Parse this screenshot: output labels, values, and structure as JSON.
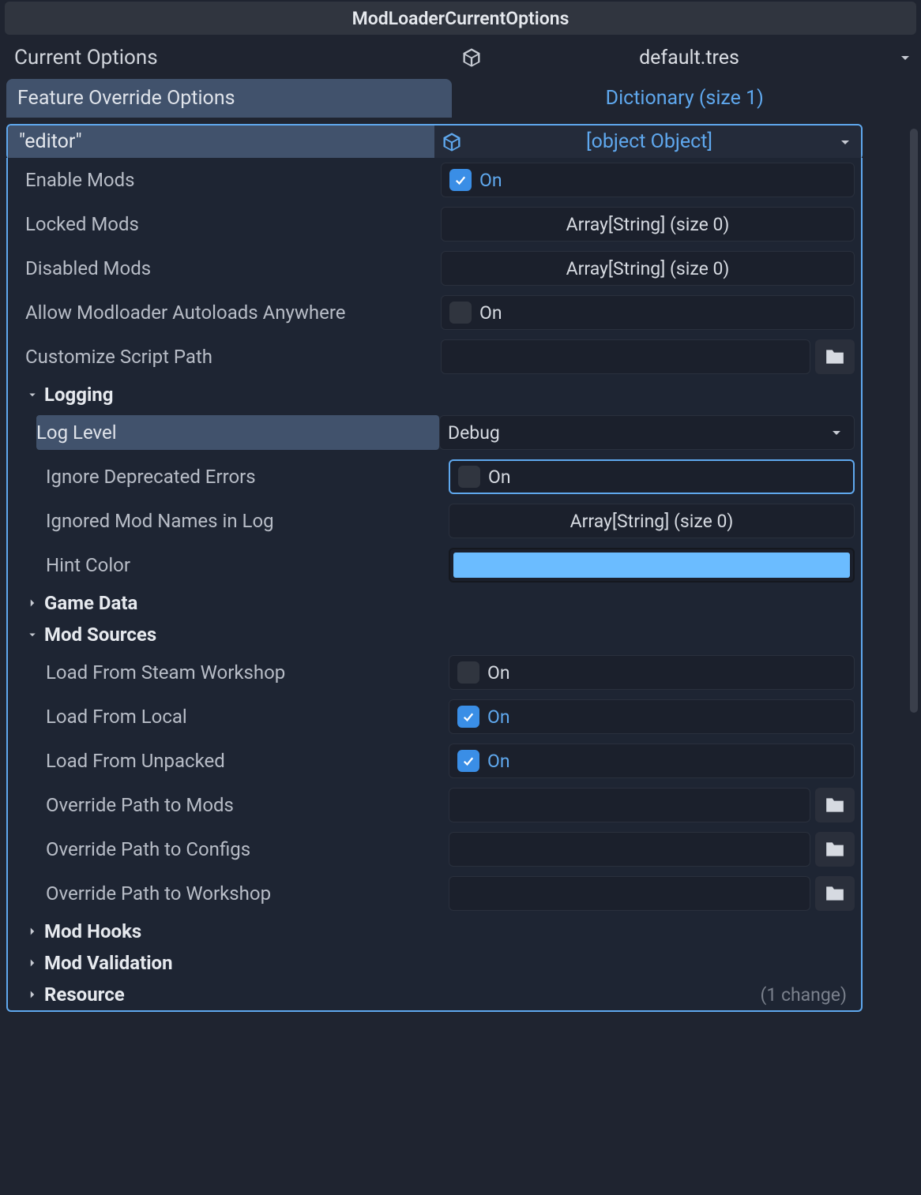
{
  "header": {
    "title": "ModLoaderCurrentOptions"
  },
  "current_options": {
    "label": "Current Options",
    "resource": "default.tres"
  },
  "feature_override": {
    "tab_label": "Feature Override Options",
    "summary": "Dictionary (size 1)"
  },
  "entry": {
    "key": "\"editor\"",
    "resource": {
      "title": "Resource",
      "note": "(1 change)"
    },
    "props": {
      "enable_mods": {
        "label": "Enable Mods",
        "checked": true,
        "text": "On"
      },
      "locked_mods": {
        "label": "Locked Mods",
        "text": "Array[String] (size 0)"
      },
      "disabled_mods": {
        "label": "Disabled Mods",
        "text": "Array[String] (size 0)"
      },
      "allow_autoloads": {
        "label": "Allow Modloader Autoloads Anywhere",
        "checked": false,
        "text": "On"
      },
      "customize_script_path": {
        "label": "Customize Script Path",
        "value": ""
      }
    },
    "logging": {
      "title": "Logging",
      "log_level": {
        "label": "Log Level",
        "value": "Debug"
      },
      "ignore_deprecated": {
        "label": "Ignore Deprecated Errors",
        "checked": false,
        "text": "On"
      },
      "ignored_names": {
        "label": "Ignored Mod Names in Log",
        "text": "Array[String] (size 0)"
      },
      "hint_color": {
        "label": "Hint Color",
        "value": "#6bbcff"
      }
    },
    "game_data": {
      "title": "Game Data"
    },
    "mod_sources": {
      "title": "Mod Sources",
      "steam": {
        "label": "Load From Steam Workshop",
        "checked": false,
        "text": "On"
      },
      "local": {
        "label": "Load From Local",
        "checked": true,
        "text": "On"
      },
      "unpacked": {
        "label": "Load From Unpacked",
        "checked": true,
        "text": "On"
      },
      "override_mods": {
        "label": "Override Path to Mods",
        "value": ""
      },
      "override_configs": {
        "label": "Override Path to Configs",
        "value": ""
      },
      "override_workshop": {
        "label": "Override Path to Workshop",
        "value": ""
      }
    },
    "mod_hooks": {
      "title": "Mod Hooks"
    },
    "mod_validation": {
      "title": "Mod Validation"
    }
  }
}
